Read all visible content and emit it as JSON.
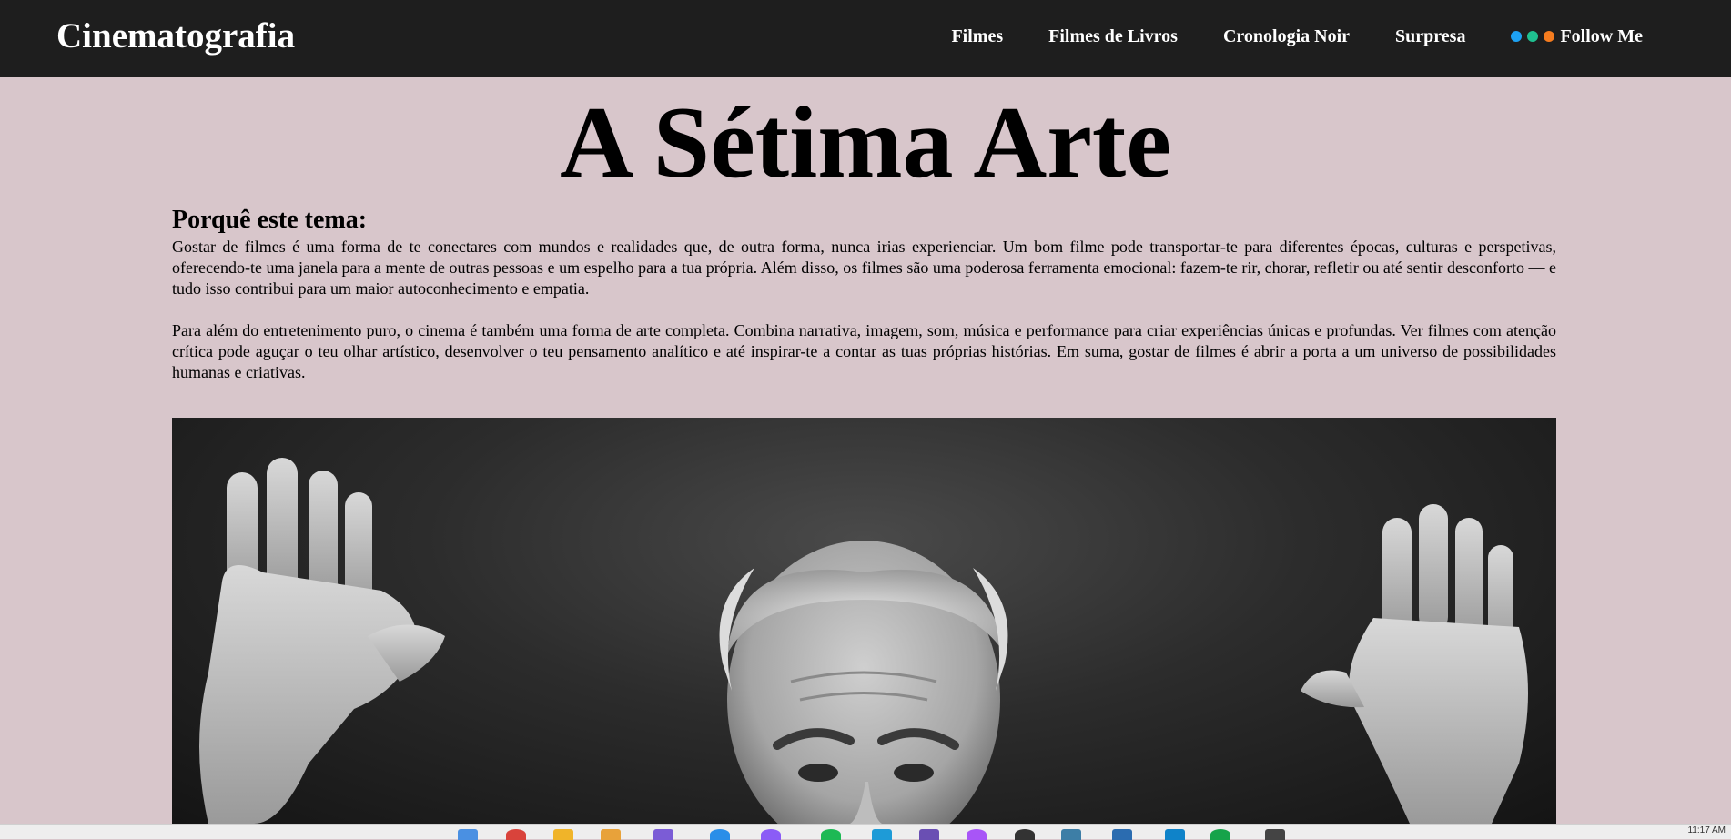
{
  "header": {
    "brand": "Cinematografia",
    "nav": [
      {
        "label": "Filmes"
      },
      {
        "label": "Filmes de Livros"
      },
      {
        "label": "Cronologia Noir"
      },
      {
        "label": "Surpresa"
      }
    ],
    "follow": {
      "label": "Follow Me",
      "dot_colors": [
        "#1da1f2",
        "#1fbf8f",
        "#f57c1f"
      ]
    }
  },
  "main": {
    "title": "A Sétima Arte",
    "section_heading": "Porquê este tema:",
    "paragraphs": [
      "Gostar de filmes é uma forma de te conectares com mundos e realidades que, de outra forma, nunca irias experienciar. Um bom filme pode transportar-te para diferentes épocas, culturas e perspetivas, oferecendo-te uma janela para a mente de outras pessoas e um espelho para a tua própria. Além disso, os filmes são uma poderosa ferramenta emocional: fazem-te rir, chorar, refletir ou até sentir desconforto — e tudo isso contribui para um maior autoconhecimento e empatia.",
      "Para além do entretenimento puro, o cinema é também uma forma de arte completa. Combina narrativa, imagem, som, música e performance para criar experiências únicas e profundas. Ver filmes com atenção crítica pode aguçar o teu olhar artístico, desenvolver o teu pensamento analítico e até inspirar-te a contar as tuas próprias histórias. Em suma, gostar de filmes é abrir a porta a um universo de possibilidades humanas e criativas."
    ]
  },
  "colors": {
    "page_background": "#d8c6cb",
    "navbar_background": "#1e1e1e",
    "nav_text": "#ffffff"
  },
  "taskbar": {
    "icons": [
      "windows-icon",
      "chrome-icon",
      "folder-icon",
      "file-icon",
      "app-icon",
      "edge-icon",
      "app-icon",
      "spotify-icon",
      "app-icon",
      "app-icon",
      "app-icon",
      "app-icon",
      "app-icon",
      "app-icon",
      "app-icon",
      "app-icon",
      "app-icon"
    ],
    "clock": "11:17 AM"
  }
}
